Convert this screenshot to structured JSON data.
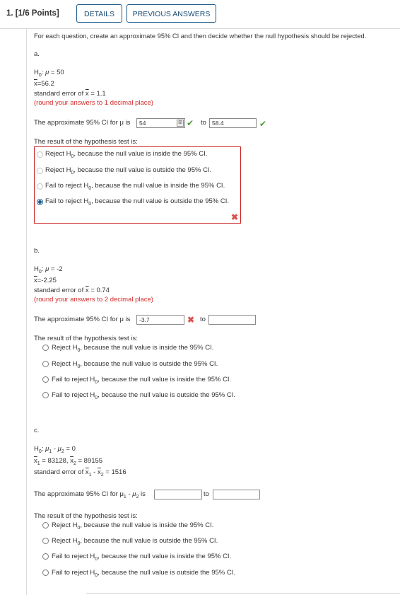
{
  "header": {
    "question_label": "1. [1/6 Points]",
    "details_button": "DETAILS",
    "previous_answers_button": "PREVIOUS ANSWERS"
  },
  "instructions": "For each question, create an approximate 95% CI and then decide whether the null hypothesis should be rejected.",
  "parts": {
    "a": {
      "label": "a.",
      "h0_value": "= 50",
      "xbar_line": "=56.2",
      "se_value": "= 1.1",
      "rounding": "(round your answers to 1 decimal place)",
      "ci_text": "The approximate 95% CI for μ is",
      "ci_low": "54",
      "ci_high": "58.4",
      "to": "to",
      "result_label": "The result of the hypothesis test is:"
    },
    "b": {
      "label": "b.",
      "h0_value": "= -2",
      "xbar_line": "=-2.25",
      "se_value": "= 0.74",
      "rounding": "(round your answers to 2 decimal place)",
      "ci_text": "The approximate 95% CI for μ is",
      "ci_low": "-3.7",
      "ci_high": "",
      "to": "to",
      "result_label": "The result of the hypothesis test is:"
    },
    "c": {
      "label": "c.",
      "h0_value": "= 0",
      "x1_value": "= 83128,",
      "x2_value": "= 89155",
      "se_value": "= 1516",
      "ci_text": "The approximate 95% CI for μ",
      "ci_low": "",
      "ci_high": "",
      "to": "to",
      "result_label": "The result of the hypothesis test is:"
    }
  },
  "common": {
    "h0_symbol": "H",
    "h0_sub": "0",
    "mu": "μ",
    "xbar": "x",
    "se_prefix": "standard error of",
    "is": "is"
  },
  "options": [
    {
      "pre": "Reject H",
      "post": ", because the null value is inside the 95% CI."
    },
    {
      "pre": "Reject H",
      "post": ", because the null value is outside the 95% CI."
    },
    {
      "pre": "Fail to reject H",
      "post": ", because the null value is inside the 95% CI."
    },
    {
      "pre": "Fail to reject H",
      "post": ", because the null value is outside the 95% CI."
    }
  ],
  "colors": {
    "accent": "#1a5a8c",
    "error": "#c82020",
    "correct": "#4a9a3a",
    "rounding_note": "#d42a2a"
  },
  "icons": {
    "correct": "✔",
    "incorrect": "✖",
    "keypad": "⊞"
  }
}
